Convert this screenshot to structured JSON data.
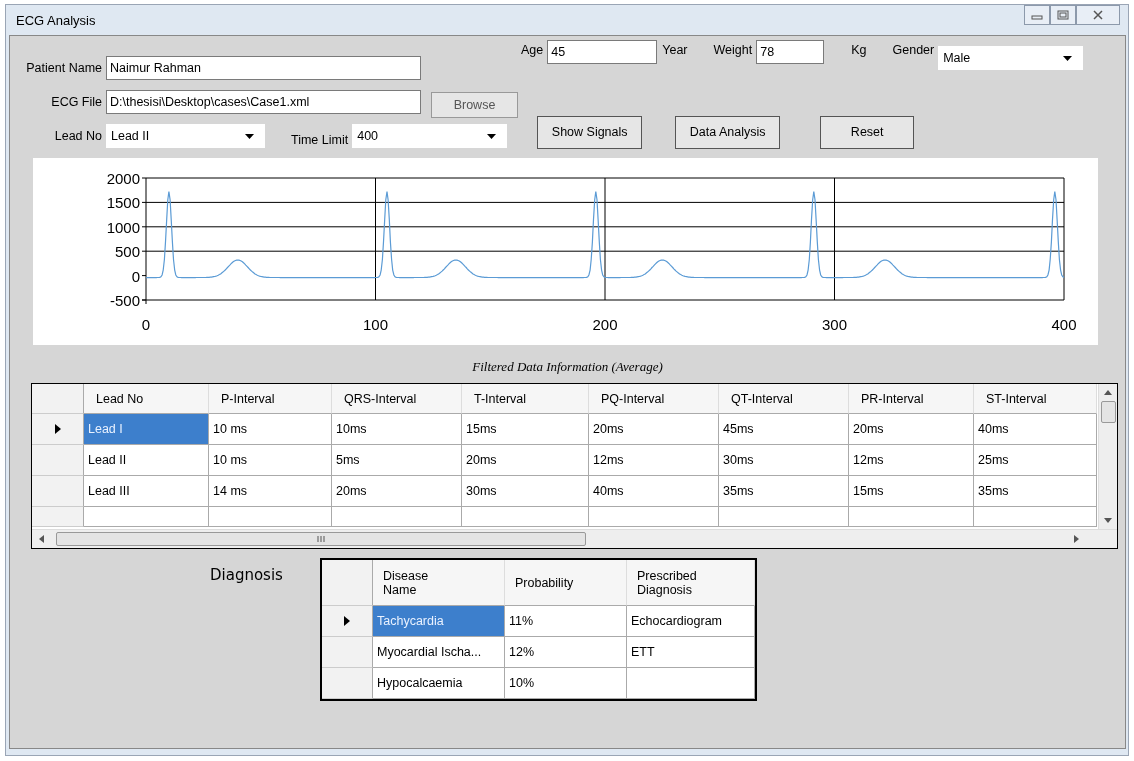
{
  "window": {
    "title": "ECG Analysis"
  },
  "form": {
    "patient_name": {
      "label": "Patient Name",
      "value": "Naimur Rahman"
    },
    "age": {
      "label": "Age",
      "value": "45",
      "unit": "Year"
    },
    "weight": {
      "label": "Weight",
      "value": "78",
      "unit": "Kg"
    },
    "gender": {
      "label": "Gender",
      "value": "Male"
    },
    "ecg_file": {
      "label": "ECG File",
      "value": "D:\\thesisi\\Desktop\\cases\\Case1.xml",
      "button": "Browse"
    },
    "lead_no": {
      "label": "Lead No",
      "value": "Lead II"
    },
    "time_limit": {
      "label": "Time Limit",
      "value": "400"
    }
  },
  "buttons": [
    "Show Signals",
    "Data Analysis",
    "Reset"
  ],
  "signal_plot": {
    "y_labels": [
      "2000",
      "1500",
      "1000",
      "500",
      "0",
      "-500"
    ],
    "x_labels": [
      "0",
      "100",
      "200",
      "300",
      "400"
    ]
  },
  "filtered_table": {
    "title": "Filtered Data Information (Average)",
    "columns": [
      "Lead No",
      "P-Interval",
      "QRS-Interval",
      "T-Interval",
      "PQ-Interval",
      "QT-Interval",
      "PR-Interval",
      "ST-Interval"
    ],
    "rows": [
      {
        "selected": true,
        "cells": [
          "Lead I",
          "10 ms",
          "10ms",
          "15ms",
          "20ms",
          "45ms",
          "20ms",
          "40ms"
        ]
      },
      {
        "selected": false,
        "cells": [
          "Lead II",
          "10 ms",
          "5ms",
          "20ms",
          "12ms",
          "30ms",
          "12ms",
          "25ms"
        ]
      },
      {
        "selected": false,
        "cells": [
          "Lead III",
          "14 ms",
          "20ms",
          "30ms",
          "40ms",
          "35ms",
          "15ms",
          "35ms"
        ]
      }
    ]
  },
  "diagnosis": {
    "label": "Diagnosis",
    "columns": [
      "Disease Name",
      "Probability",
      "Prescribed Diagnosis"
    ],
    "rows": [
      {
        "selected": true,
        "cells": [
          "Tachycardia",
          "11%",
          "Echocardiogram"
        ]
      },
      {
        "selected": false,
        "cells": [
          "Myocardial Ischa...",
          "12%",
          "ETT"
        ]
      },
      {
        "selected": false,
        "cells": [
          "Hypocalcaemia",
          "10%",
          ""
        ]
      }
    ]
  }
}
